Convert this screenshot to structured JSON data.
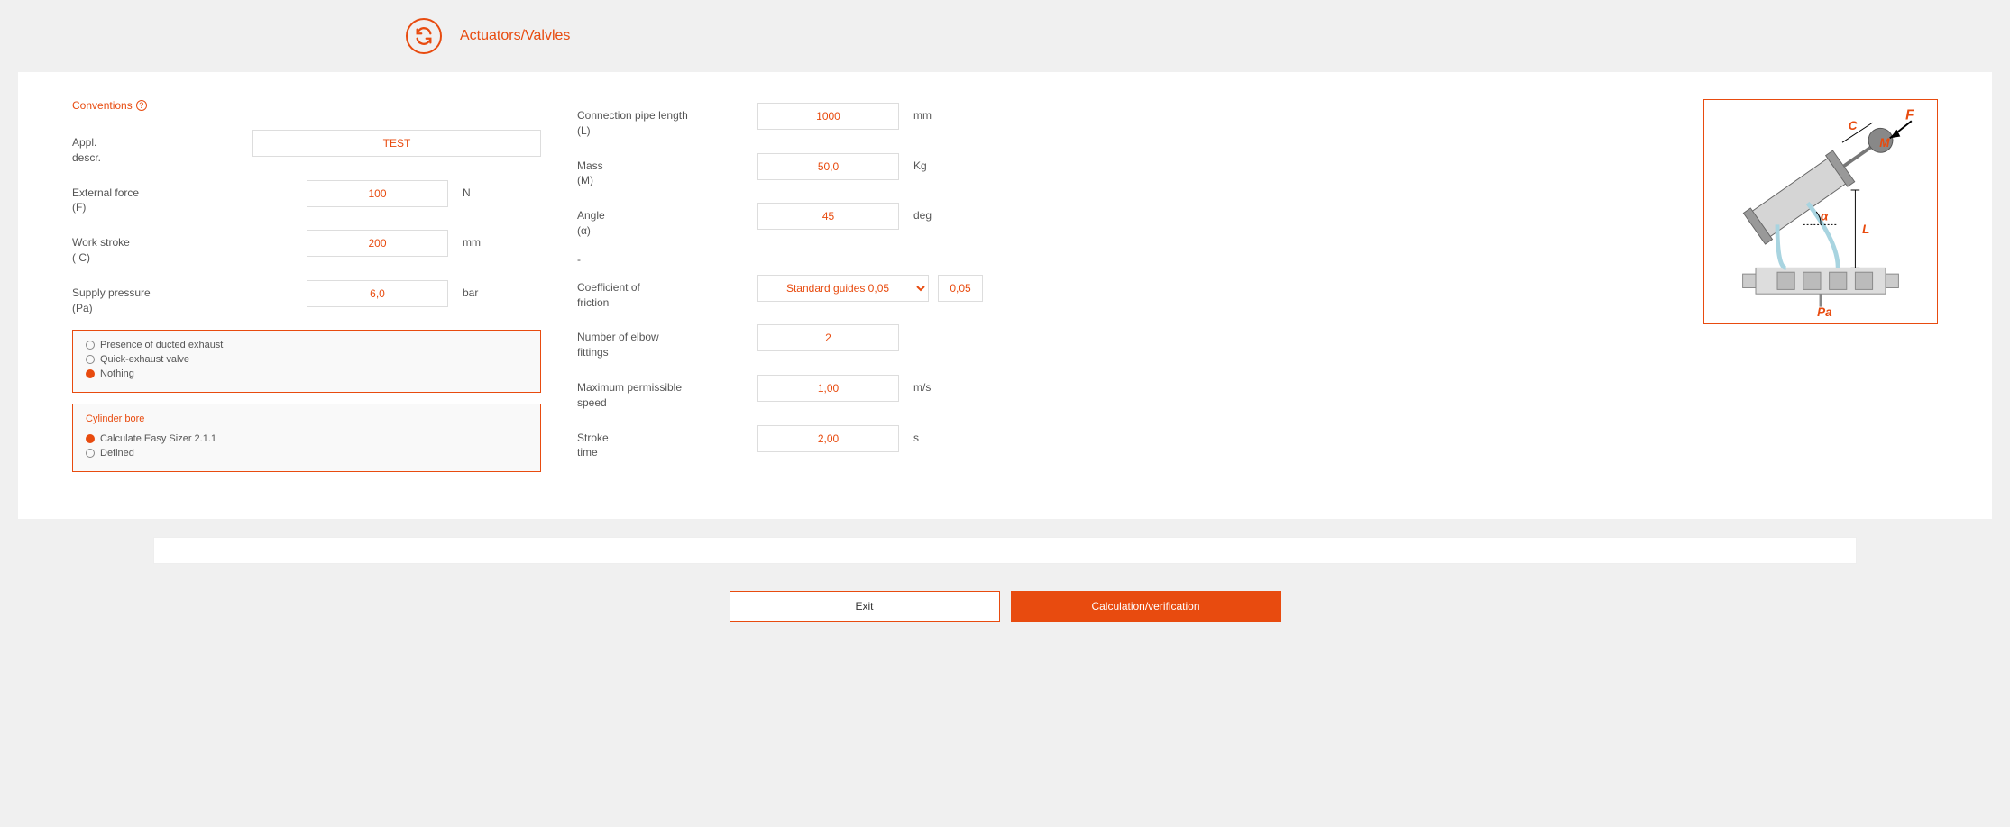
{
  "header": {
    "title": "Actuators/Valvles"
  },
  "conventions": {
    "label": "Conventions"
  },
  "left": {
    "appl_label_1": "Appl.",
    "appl_label_2": "descr.",
    "appl_value": "TEST",
    "ext_force_label_1": "External force",
    "ext_force_label_2": "(F)",
    "ext_force_value": "100",
    "ext_force_unit": "N",
    "stroke_label_1": "Work stroke",
    "stroke_label_2": "( C)",
    "stroke_value": "200",
    "stroke_unit": "mm",
    "supply_label_1": "Supply pressure",
    "supply_label_2": "(Pa)",
    "supply_value": "6,0",
    "supply_unit": "bar"
  },
  "right": {
    "pipe_label_1": "Connection pipe length",
    "pipe_label_2": "(L)",
    "pipe_value": "1000",
    "pipe_unit": "mm",
    "mass_label_1": "Mass",
    "mass_label_2": "(M)",
    "mass_value": "50,0",
    "mass_unit": "Kg",
    "angle_label_1": "Angle",
    "angle_label_2": "(α)",
    "angle_value": "45",
    "angle_unit": "deg",
    "dash": "-",
    "cof_label_1": "Coefficient of",
    "cof_label_2": "friction",
    "cof_select": "Standard guides 0,05",
    "cof_value": "0,05",
    "elbow_label_1": "Number of elbow",
    "elbow_label_2": "fittings",
    "elbow_value": "2",
    "speed_label_1": "Maximum permissible",
    "speed_label_2": "speed",
    "speed_value": "1,00",
    "speed_unit": "m/s",
    "stroketime_label_1": "Stroke",
    "stroketime_label_2": "time",
    "stroketime_value": "2,00",
    "stroketime_unit": "s"
  },
  "exhaust": {
    "opt1": "Presence of ducted exhaust",
    "opt2": "Quick-exhaust valve",
    "opt3": "Nothing",
    "selected": "opt3"
  },
  "bore": {
    "title": "Cylinder bore",
    "opt1": "Calculate Easy Sizer 2.1.1",
    "opt2": "Defined",
    "selected": "opt1"
  },
  "buttons": {
    "exit": "Exit",
    "calc": "Calculation/verification"
  },
  "diagram": {
    "F": "F",
    "M": "M",
    "C": "C",
    "L": "L",
    "alpha": "α",
    "Pa": "Pa"
  }
}
